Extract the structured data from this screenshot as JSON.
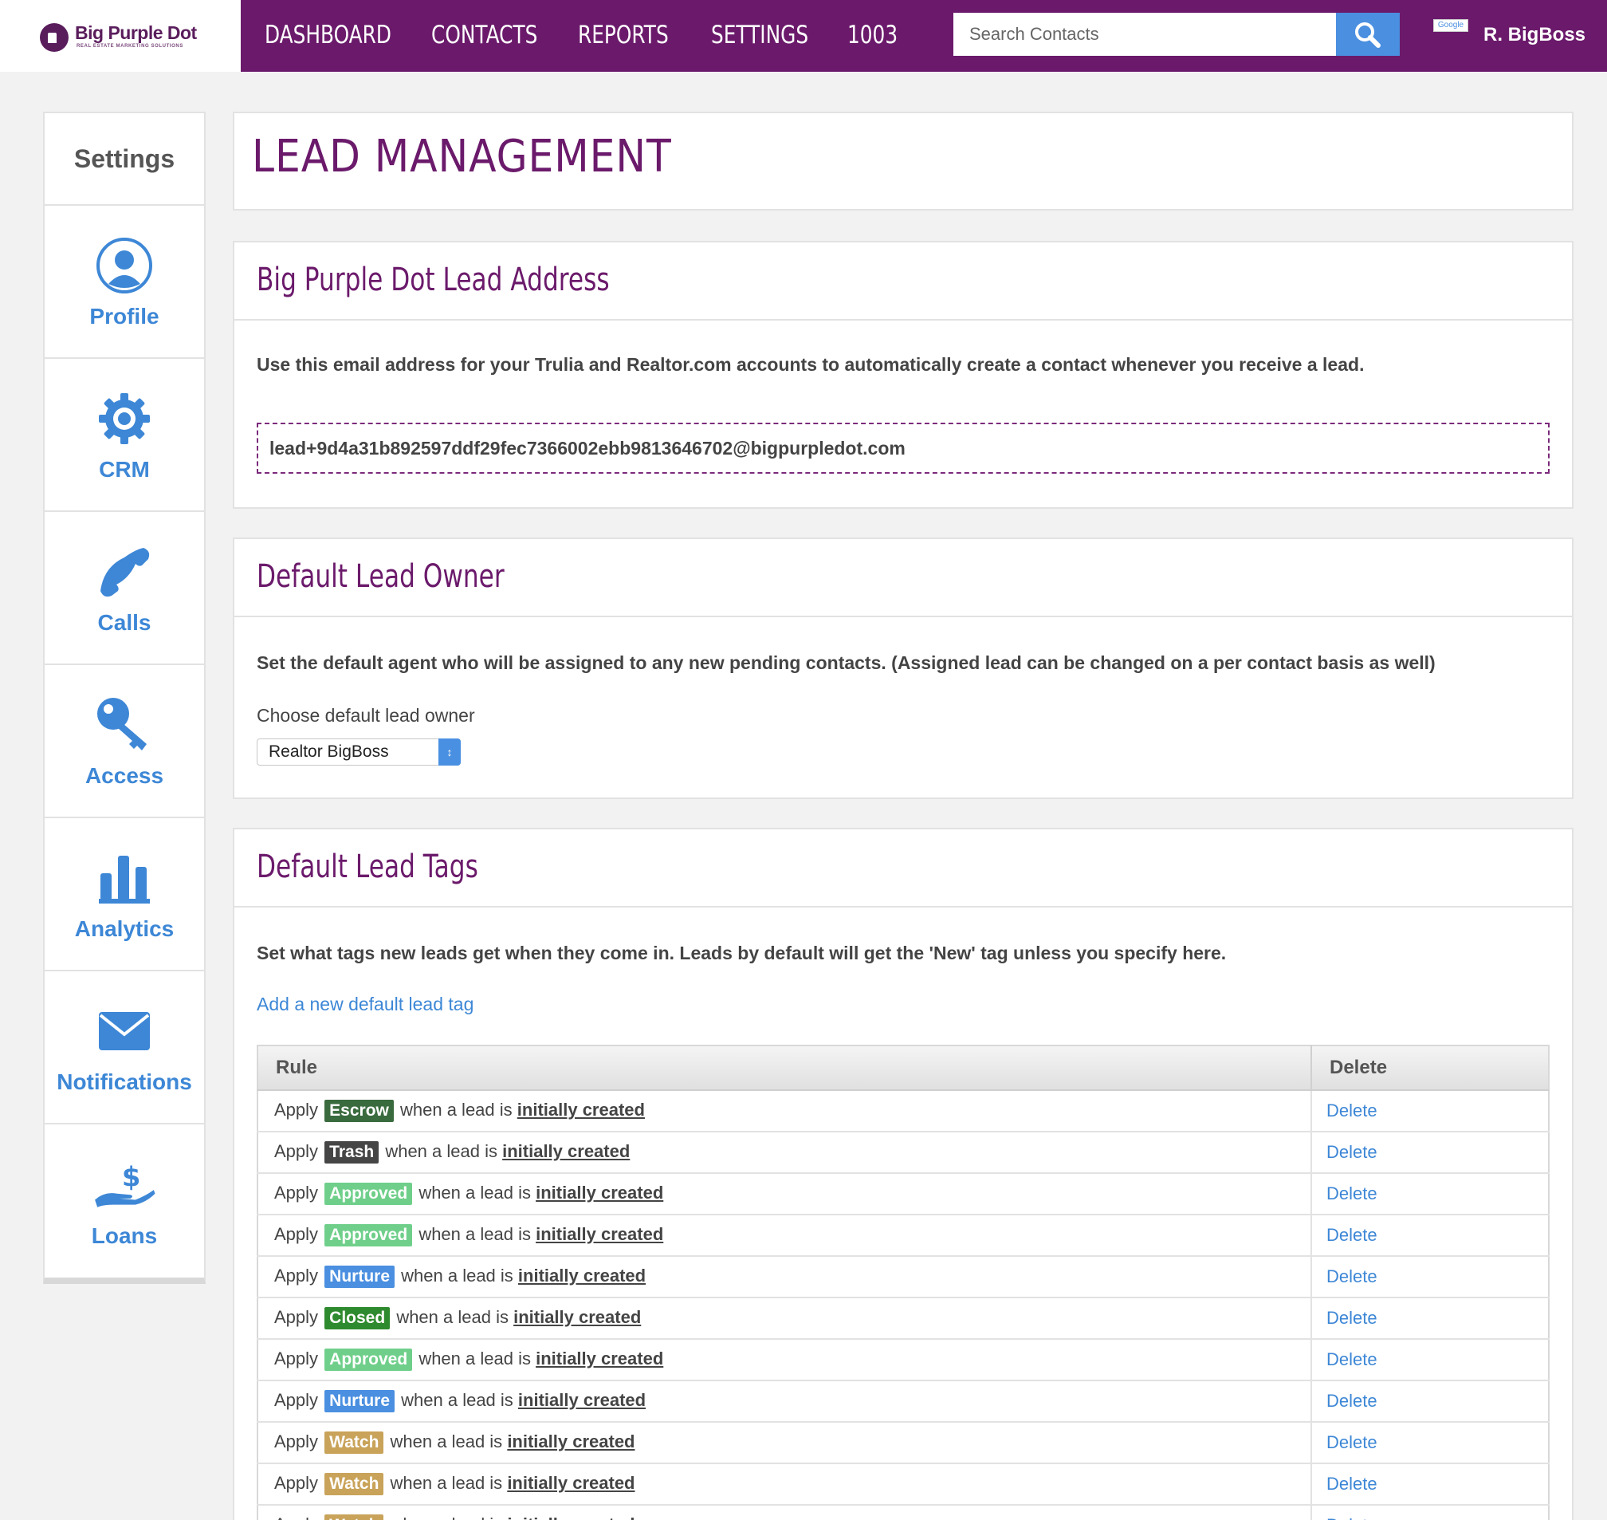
{
  "brand": {
    "name": "Big Purple Dot",
    "tagline": "REAL ESTATE MARKETING SOLUTIONS",
    "color": "#6b1a6b"
  },
  "nav": {
    "items": [
      "DASHBOARD",
      "CONTACTS",
      "REPORTS",
      "SETTINGS",
      "1003"
    ],
    "search_placeholder": "Search Contacts",
    "google_badge": "Google",
    "user": "R. BigBoss"
  },
  "sidebar": {
    "heading": "Settings",
    "items": [
      {
        "label": "Profile",
        "icon": "profile-icon"
      },
      {
        "label": "CRM",
        "icon": "gear-icon"
      },
      {
        "label": "Calls",
        "icon": "phone-icon"
      },
      {
        "label": "Access",
        "icon": "key-icon"
      },
      {
        "label": "Analytics",
        "icon": "bar-chart-icon"
      },
      {
        "label": "Notifications",
        "icon": "envelope-icon"
      },
      {
        "label": "Loans",
        "icon": "money-hand-icon"
      }
    ]
  },
  "page": {
    "title": "LEAD MANAGEMENT"
  },
  "lead_address": {
    "heading": "Big Purple Dot Lead Address",
    "description": "Use this email address for your Trulia and Realtor.com accounts to automatically create a contact whenever you receive a lead.",
    "email": "lead+9d4a31b892597ddf29fec7366002ebb9813646702@bigpurpledot.com"
  },
  "lead_owner": {
    "heading": "Default Lead Owner",
    "description": "Set the default agent who will be assigned to any new pending contacts. (Assigned lead can be changed on a per contact basis as well)",
    "label": "Choose default lead owner",
    "selected": "Realtor BigBoss"
  },
  "lead_tags": {
    "heading": "Default Lead Tags",
    "description": "Set what tags new leads get when they come in. Leads by default will get the 'New' tag unless you specify here.",
    "add_link": "Add a new default lead tag",
    "columns": [
      "Rule",
      "Delete"
    ],
    "rule_prefix": "Apply",
    "rule_middle": "when a lead is",
    "rule_event": "initially created",
    "delete_label": "Delete",
    "rows": [
      {
        "tag": "Escrow",
        "color": "#3a6b3e"
      },
      {
        "tag": "Trash",
        "color": "#454545"
      },
      {
        "tag": "Approved",
        "color": "#6fcf8a"
      },
      {
        "tag": "Approved",
        "color": "#6fcf8a"
      },
      {
        "tag": "Nurture",
        "color": "#4a8fe0"
      },
      {
        "tag": "Closed",
        "color": "#2e8a2e"
      },
      {
        "tag": "Approved",
        "color": "#6fcf8a"
      },
      {
        "tag": "Nurture",
        "color": "#4a8fe0"
      },
      {
        "tag": "Watch",
        "color": "#c9a35a"
      },
      {
        "tag": "Watch",
        "color": "#c9a35a"
      },
      {
        "tag": "Watch",
        "color": "#c9a35a"
      }
    ]
  }
}
